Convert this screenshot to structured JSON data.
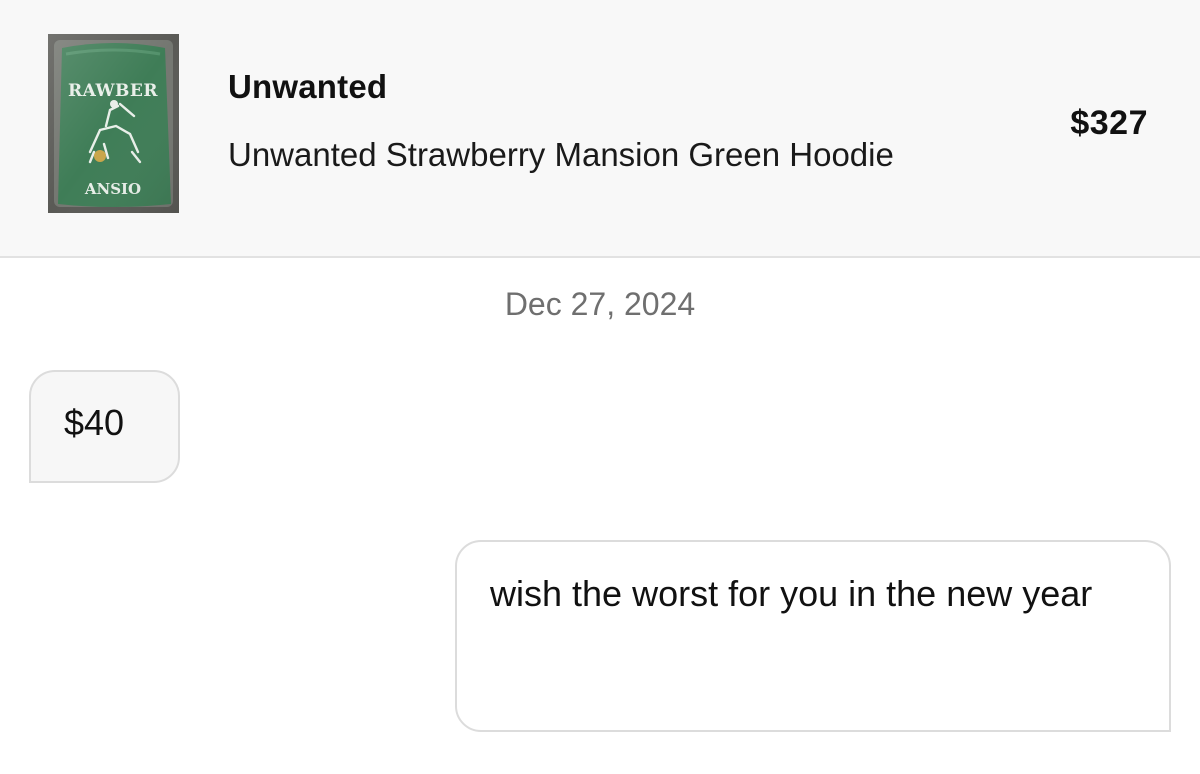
{
  "listing": {
    "brand": "Unwanted",
    "title": "Unwanted Strawberry Mansion Green Hoodie",
    "price": "$327",
    "thumbnail": {
      "icon": "hoodie-product-photo",
      "print_text": "STRAWBERRY MANSION",
      "garment_color": "#3f7d57",
      "bag_color": "#5a5a56"
    }
  },
  "conversation": {
    "date": "Dec 27, 2024",
    "messages": [
      {
        "direction": "incoming",
        "text": "$40"
      },
      {
        "direction": "outgoing",
        "text": "wish the worst for you in the new year"
      }
    ]
  }
}
